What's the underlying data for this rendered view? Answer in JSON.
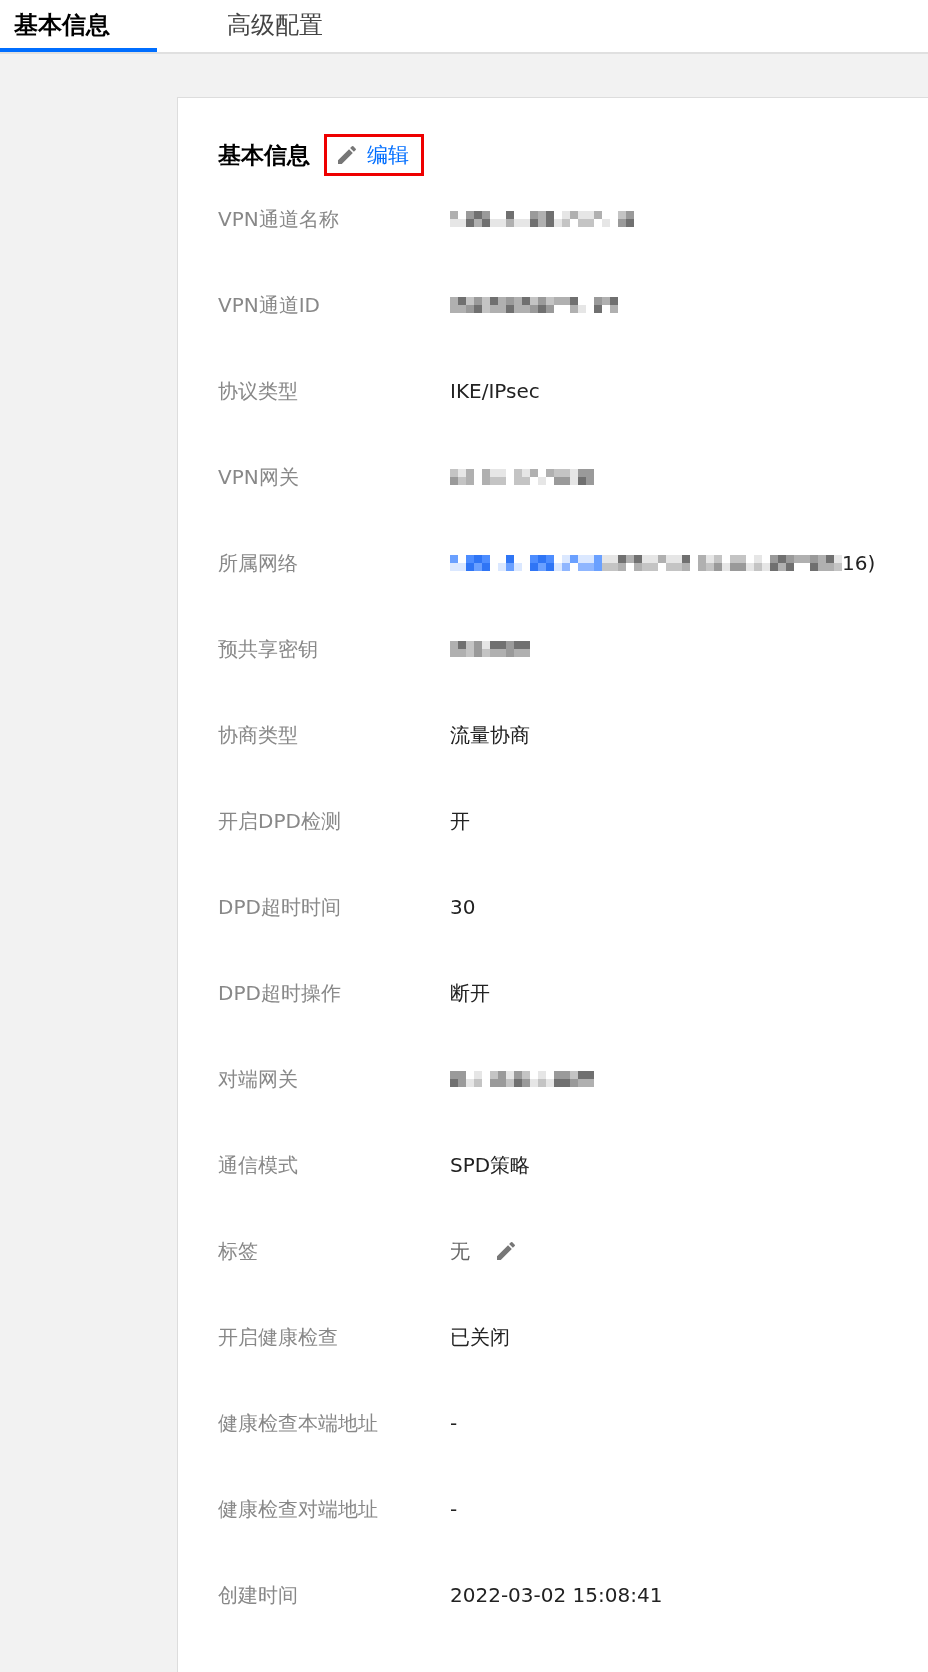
{
  "tabs": [
    {
      "label": "基本信息",
      "selected": true
    },
    {
      "label": "高级配置",
      "selected": false
    }
  ],
  "section": {
    "title": "基本信息",
    "edit_link": "编辑",
    "highlighted": true
  },
  "rows": [
    {
      "label": "VPN通道名称",
      "kind": "redacted"
    },
    {
      "label": "VPN通道ID",
      "kind": "redacted"
    },
    {
      "label": "协议类型",
      "kind": "text",
      "value": "IKE/IPsec"
    },
    {
      "label": "VPN网关",
      "kind": "redacted"
    },
    {
      "label": "所属网络",
      "kind": "network",
      "suffix": "16)"
    },
    {
      "label": "预共享密钥",
      "kind": "redacted"
    },
    {
      "label": "协商类型",
      "kind": "text",
      "value": "流量协商"
    },
    {
      "label": "开启DPD检测",
      "kind": "text",
      "value": "开"
    },
    {
      "label": "DPD超时时间",
      "kind": "text",
      "value": "30"
    },
    {
      "label": "DPD超时操作",
      "kind": "text",
      "value": "断开"
    },
    {
      "label": "对端网关",
      "kind": "redacted"
    },
    {
      "label": "通信模式",
      "kind": "text",
      "value": "SPD策略"
    },
    {
      "label": "标签",
      "kind": "tag",
      "value": "无"
    },
    {
      "label": "开启健康检查",
      "kind": "text",
      "value": "已关闭"
    },
    {
      "label": "健康检查本端地址",
      "kind": "text",
      "value": "-"
    },
    {
      "label": "健康检查对端地址",
      "kind": "text",
      "value": "-"
    },
    {
      "label": "创建时间",
      "kind": "text",
      "value": "2022-03-02 15:08:41"
    }
  ]
}
